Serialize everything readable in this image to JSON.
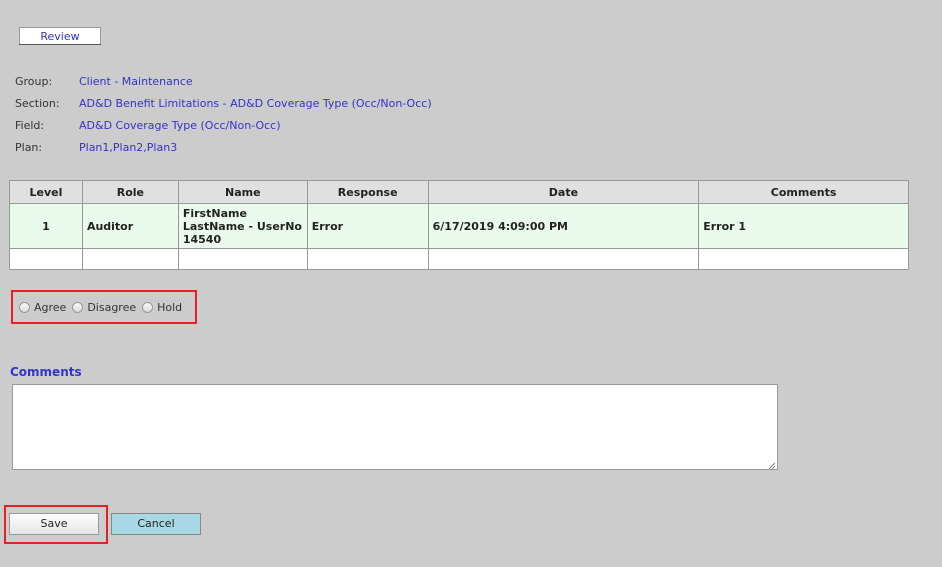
{
  "tab": {
    "label": "Review"
  },
  "info": [
    {
      "label": "Group:",
      "value": "Client - Maintenance"
    },
    {
      "label": "Section:",
      "value": "AD&D Benefit Limitations - AD&D Coverage Type (Occ/Non-Occ)"
    },
    {
      "label": "Field:",
      "value": "AD&D Coverage Type (Occ/Non-Occ)"
    },
    {
      "label": "Plan:",
      "value": "Plan1,Plan2,Plan3"
    }
  ],
  "table": {
    "headers": [
      "Level",
      "Role",
      "Name",
      "Response",
      "Date",
      "Comments"
    ],
    "rows": [
      {
        "level": "1",
        "role": "Auditor",
        "name_line1": "FirstName",
        "name_line2": "LastName - UserNo",
        "name_line3": "14540",
        "response": "Error",
        "date": "6/17/2019 4:09:00 PM",
        "comments": "Error 1"
      }
    ]
  },
  "decision": {
    "agree": "Agree",
    "disagree": "Disagree",
    "hold": "Hold"
  },
  "comments": {
    "title": "Comments",
    "value": ""
  },
  "buttons": {
    "save": "Save",
    "cancel": "Cancel"
  },
  "colors": {
    "background": "#cccccc",
    "link": "#3333cc",
    "row_highlight": "#ebfbeb",
    "annotation": "#e82020",
    "cancel_button": "#a8d8e6"
  }
}
